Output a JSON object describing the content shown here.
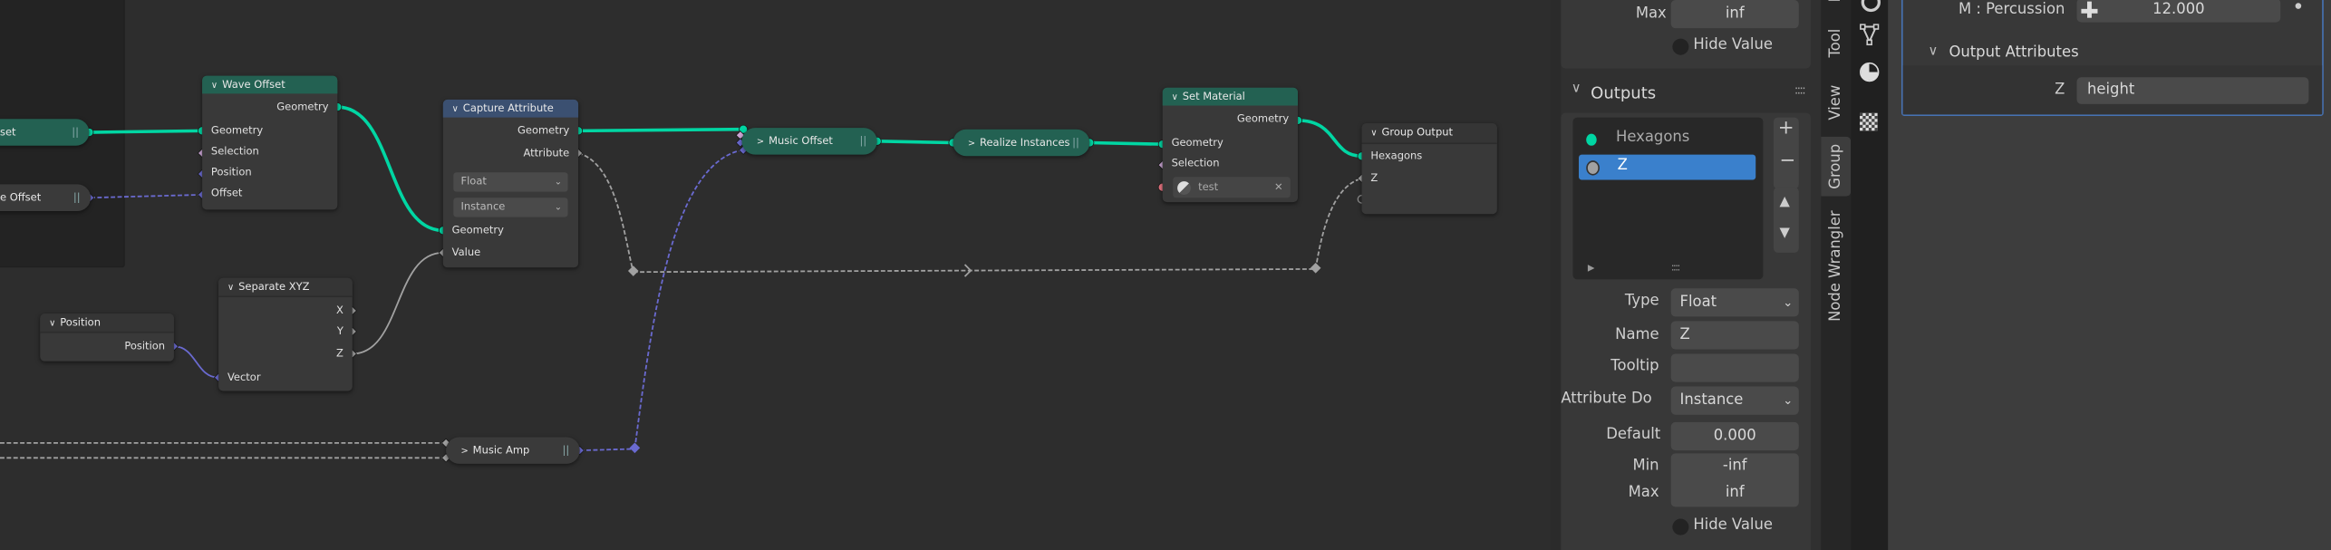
{
  "nodes": {
    "wave_offset_partial": {
      "label": "set"
    },
    "e_offset_partial": {
      "label": "e Offset"
    },
    "wave_offset": {
      "title": "Wave Offset",
      "outputs": [
        "Geometry"
      ],
      "inputs": [
        "Geometry",
        "Selection",
        "Position",
        "Offset"
      ]
    },
    "capture_attribute": {
      "title": "Capture Attribute",
      "outputs": [
        "Geometry",
        "Attribute"
      ],
      "data_type": "Float",
      "domain": "Instance",
      "inputs": [
        "Geometry",
        "Value"
      ]
    },
    "separate_xyz": {
      "title": "Separate XYZ",
      "outputs": [
        "X",
        "Y",
        "Z"
      ],
      "inputs": [
        "Vector"
      ]
    },
    "position": {
      "title": "Position",
      "outputs": [
        "Position"
      ]
    },
    "music_offset": {
      "title": "Music Offset"
    },
    "realize_instances": {
      "title": "Realize Instances"
    },
    "music_amp": {
      "title": "Music Amp"
    },
    "set_material": {
      "title": "Set Material",
      "outputs": [
        "Geometry"
      ],
      "inputs": [
        "Geometry",
        "Selection"
      ],
      "material": "test"
    },
    "group_output": {
      "title": "Group Output",
      "inputs": [
        "Hexagons",
        "Z"
      ]
    }
  },
  "colors": {
    "geometry": "#00d6a3",
    "vector": "#6363c7",
    "float": "#a1a1a1",
    "field": "#cca6d6",
    "material": "#eb7582",
    "selection": "#4772b3",
    "green_header": "#236152",
    "blue_header": "#3b5071"
  },
  "sidebar": {
    "top": {
      "max_label": "Max",
      "max_value": "inf",
      "hide_value": "Hide Value"
    },
    "outputs": {
      "title": "Outputs",
      "items": [
        {
          "name": "Hexagons",
          "color": "#00d6a3"
        },
        {
          "name": "Z",
          "color": "#a1a1a1",
          "selected": true
        }
      ],
      "type_label": "Type",
      "type_value": "Float",
      "name_label": "Name",
      "name_value": "Z",
      "tooltip_label": "Tooltip",
      "tooltip_value": "",
      "domain_label": "Attribute Do",
      "domain_value": "Instance",
      "default_label": "Default",
      "default_value": "0.000",
      "min_label": "Min",
      "min_value": "-inf",
      "max_label": "Max",
      "max_value": "inf",
      "hide_value": "Hide Value"
    },
    "tabs": [
      "Tool",
      "View",
      "Group",
      "Node Wrangler"
    ],
    "active_tab": "Group"
  },
  "properties": {
    "percussion_label": "M : Percussion",
    "percussion_value": "12.000",
    "output_attributes_title": "Output Attributes",
    "z_label": "Z",
    "z_value": "height"
  }
}
